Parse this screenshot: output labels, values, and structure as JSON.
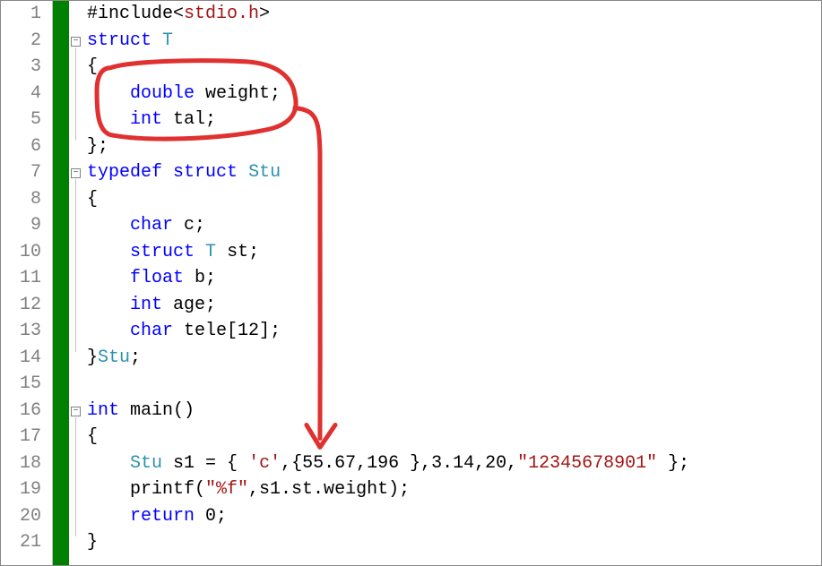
{
  "editor": {
    "lines": [
      {
        "n": "1",
        "tokens": [
          {
            "c": "inc",
            "t": "#include"
          },
          {
            "c": "punct",
            "t": "<"
          },
          {
            "c": "str",
            "t": "stdio.h"
          },
          {
            "c": "punct",
            "t": ">"
          }
        ],
        "indent": 0,
        "fold": null
      },
      {
        "n": "2",
        "tokens": [
          {
            "c": "kw",
            "t": "struct"
          },
          {
            "c": "",
            "t": " "
          },
          {
            "c": "userType",
            "t": "T"
          }
        ],
        "indent": 0,
        "fold": "minus"
      },
      {
        "n": "3",
        "tokens": [
          {
            "c": "punct",
            "t": "{"
          }
        ],
        "indent": 0
      },
      {
        "n": "4",
        "tokens": [
          {
            "c": "kw",
            "t": "double"
          },
          {
            "c": "",
            "t": " "
          },
          {
            "c": "ident",
            "t": "weight;"
          }
        ],
        "indent": 1
      },
      {
        "n": "5",
        "tokens": [
          {
            "c": "kw",
            "t": "int"
          },
          {
            "c": "",
            "t": " "
          },
          {
            "c": "ident",
            "t": "tal;"
          }
        ],
        "indent": 1
      },
      {
        "n": "6",
        "tokens": [
          {
            "c": "punct",
            "t": "};"
          }
        ],
        "indent": 0
      },
      {
        "n": "7",
        "tokens": [
          {
            "c": "kw",
            "t": "typedef"
          },
          {
            "c": "",
            "t": " "
          },
          {
            "c": "kw",
            "t": "struct"
          },
          {
            "c": "",
            "t": " "
          },
          {
            "c": "userType",
            "t": "Stu"
          }
        ],
        "indent": 0,
        "fold": "minus"
      },
      {
        "n": "8",
        "tokens": [
          {
            "c": "punct",
            "t": "{"
          }
        ],
        "indent": 0
      },
      {
        "n": "9",
        "tokens": [
          {
            "c": "kw",
            "t": "char"
          },
          {
            "c": "",
            "t": " "
          },
          {
            "c": "ident",
            "t": "c;"
          }
        ],
        "indent": 1
      },
      {
        "n": "10",
        "tokens": [
          {
            "c": "kw",
            "t": "struct"
          },
          {
            "c": "",
            "t": " "
          },
          {
            "c": "userType",
            "t": "T"
          },
          {
            "c": "",
            "t": " "
          },
          {
            "c": "ident",
            "t": "st;"
          }
        ],
        "indent": 1
      },
      {
        "n": "11",
        "tokens": [
          {
            "c": "kw",
            "t": "float"
          },
          {
            "c": "",
            "t": " "
          },
          {
            "c": "ident",
            "t": "b;"
          }
        ],
        "indent": 1
      },
      {
        "n": "12",
        "tokens": [
          {
            "c": "kw",
            "t": "int"
          },
          {
            "c": "",
            "t": " "
          },
          {
            "c": "ident",
            "t": "age;"
          }
        ],
        "indent": 1
      },
      {
        "n": "13",
        "tokens": [
          {
            "c": "kw",
            "t": "char"
          },
          {
            "c": "",
            "t": " "
          },
          {
            "c": "ident",
            "t": "tele[12];"
          }
        ],
        "indent": 1
      },
      {
        "n": "14",
        "tokens": [
          {
            "c": "punct",
            "t": "}"
          },
          {
            "c": "userType",
            "t": "Stu"
          },
          {
            "c": "punct",
            "t": ";"
          }
        ],
        "indent": 0
      },
      {
        "n": "15",
        "tokens": [],
        "indent": 0
      },
      {
        "n": "16",
        "tokens": [
          {
            "c": "kw",
            "t": "int"
          },
          {
            "c": "",
            "t": " "
          },
          {
            "c": "ident",
            "t": "main()"
          }
        ],
        "indent": 0,
        "fold": "minus"
      },
      {
        "n": "17",
        "tokens": [
          {
            "c": "punct",
            "t": "{"
          }
        ],
        "indent": 0
      },
      {
        "n": "18",
        "tokens": [
          {
            "c": "userType",
            "t": "Stu"
          },
          {
            "c": "",
            "t": " "
          },
          {
            "c": "ident",
            "t": "s1 = { "
          },
          {
            "c": "str",
            "t": "'c'"
          },
          {
            "c": "ident",
            "t": ",{55.67,196 },3.14,20,"
          },
          {
            "c": "str",
            "t": "\"12345678901\""
          },
          {
            "c": "ident",
            "t": " };"
          }
        ],
        "indent": 1
      },
      {
        "n": "19",
        "tokens": [
          {
            "c": "ident",
            "t": "printf("
          },
          {
            "c": "str",
            "t": "\"%f\""
          },
          {
            "c": "ident",
            "t": ",s1.st.weight);"
          }
        ],
        "indent": 1
      },
      {
        "n": "20",
        "tokens": [
          {
            "c": "kw",
            "t": "return"
          },
          {
            "c": "",
            "t": " "
          },
          {
            "c": "ident",
            "t": "0;"
          }
        ],
        "indent": 1
      },
      {
        "n": "21",
        "tokens": [
          {
            "c": "punct",
            "t": "}"
          }
        ],
        "indent": 0
      }
    ]
  },
  "annotation": {
    "color": "#e03030"
  }
}
